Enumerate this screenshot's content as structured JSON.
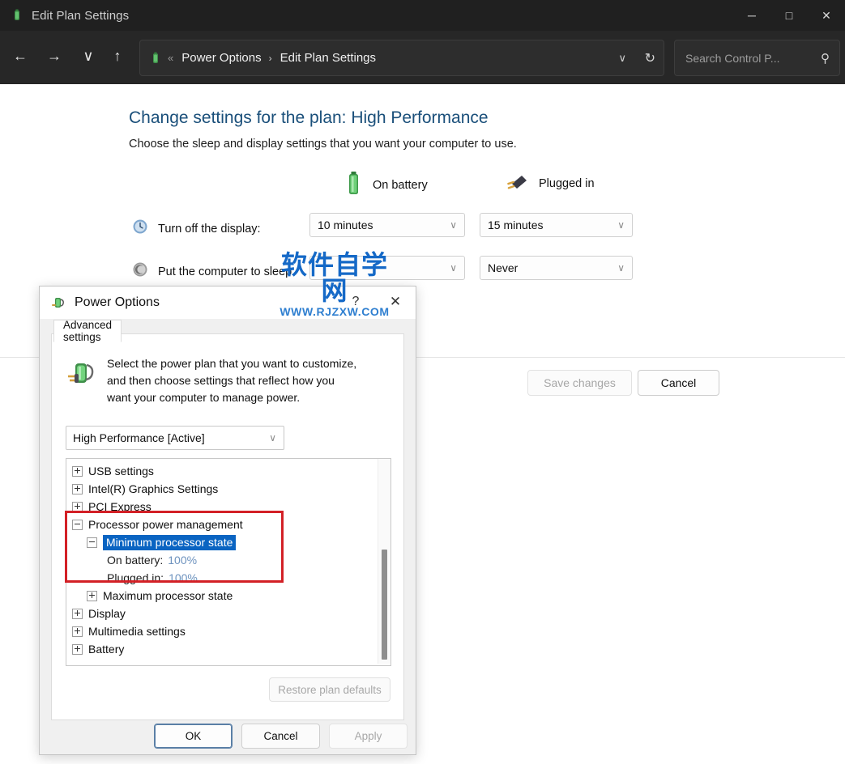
{
  "window": {
    "title": "Edit Plan Settings",
    "icon": "power-plan-icon",
    "minimize_label": "─",
    "maximize_label": "□",
    "close_label": "✕"
  },
  "nav": {
    "back_label": "←",
    "forward_label": "→",
    "recent_label": "∨",
    "up_label": "↑",
    "address_chevrons": "«",
    "breadcrumbs": [
      {
        "label": "Power Options"
      },
      {
        "label": "Edit Plan Settings"
      }
    ],
    "separator": "›",
    "dropdown_label": "∨",
    "refresh_label": "↻"
  },
  "search": {
    "placeholder": "Search Control P...",
    "value": "",
    "icon_label": "⚲"
  },
  "page": {
    "title": "Change settings for the plan: High Performance",
    "subtitle": "Choose the sleep and display settings that you want your computer to use.",
    "columns": [
      {
        "label": "On battery",
        "icon": "battery-icon"
      },
      {
        "label": "Plugged in",
        "icon": "power-plug-icon"
      }
    ],
    "rows": [
      {
        "label": "Turn off the display:",
        "icon": "display-clock-icon",
        "on_battery": "10 minutes",
        "plugged_in": "15 minutes"
      },
      {
        "label": "Put the computer to sleep:",
        "icon": "sleep-moon-icon",
        "on_battery": "",
        "plugged_in": "Never"
      }
    ],
    "chevron": "∨",
    "save_label": "Save changes",
    "cancel_label": "Cancel"
  },
  "watermark": {
    "text_cn": "软件自学网",
    "text_url": "WWW.RJZXW.COM",
    "color": "#1569c7"
  },
  "dialog": {
    "title": "Power Options",
    "icon": "power-options-icon",
    "help_label": "?",
    "close_label": "✕",
    "tab_label": "Advanced settings",
    "intro_text": "Select the power plan that you want to customize, and then choose settings that reflect how you want your computer to manage power.",
    "intro_icon": "power-plan-large-icon",
    "plan_value": "High Performance [Active]",
    "plan_chevron": "∨",
    "tree": [
      {
        "label": "USB settings",
        "level": 1,
        "state": "collapsed"
      },
      {
        "label": "Intel(R) Graphics Settings",
        "level": 1,
        "state": "collapsed"
      },
      {
        "label": "PCI Express",
        "level": 1,
        "state": "collapsed"
      },
      {
        "label": "Processor power management",
        "level": 1,
        "state": "expanded"
      },
      {
        "label": "Minimum processor state",
        "level": 2,
        "state": "expanded",
        "selected": true
      },
      {
        "label": "On battery:",
        "level": 3,
        "state": "value",
        "value": "100%"
      },
      {
        "label": "Plugged in:",
        "level": 3,
        "state": "value",
        "value": "100%"
      },
      {
        "label": "Maximum processor state",
        "level": 2,
        "state": "collapsed"
      },
      {
        "label": "Display",
        "level": 1,
        "state": "collapsed"
      },
      {
        "label": "Multimedia settings",
        "level": 1,
        "state": "collapsed"
      },
      {
        "label": "Battery",
        "level": 1,
        "state": "collapsed"
      }
    ],
    "restore_label": "Restore plan defaults",
    "ok_label": "OK",
    "cancel_label": "Cancel",
    "apply_label": "Apply",
    "highlight_color": "#d32026",
    "selection_color": "#0a64c2",
    "value_color": "#6d92be"
  }
}
